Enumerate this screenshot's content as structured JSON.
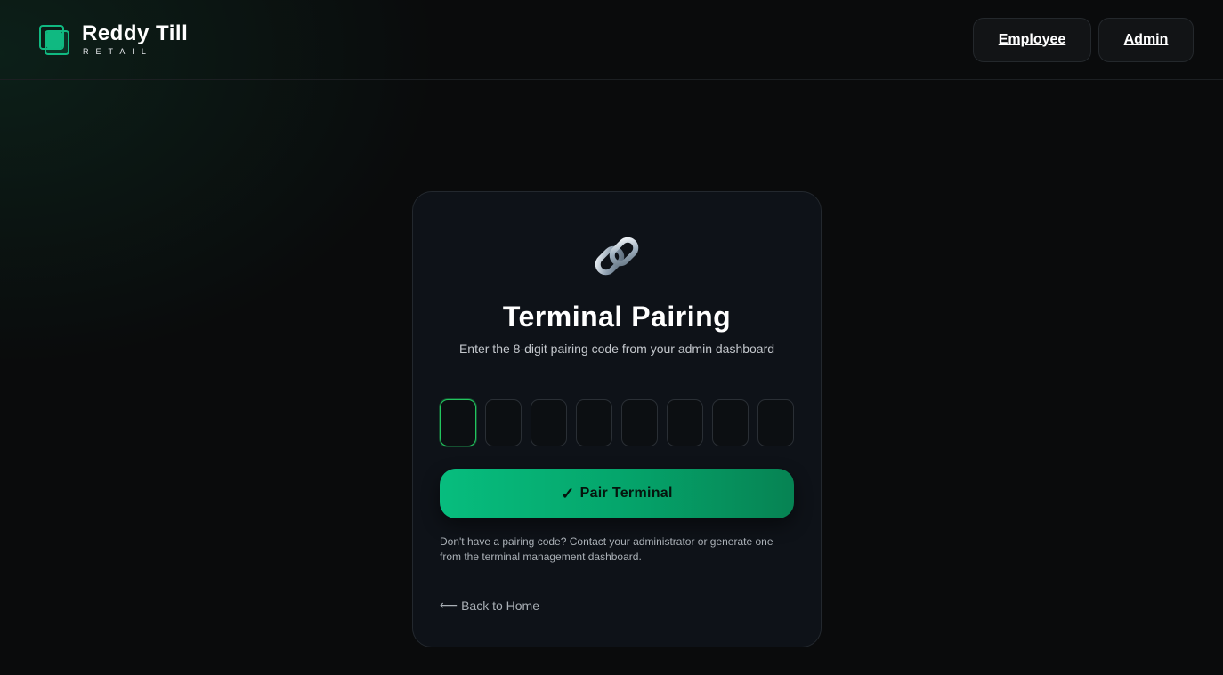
{
  "header": {
    "brand_name": "Reddy Till",
    "brand_sub": "RETAIL",
    "nav": {
      "employee_label": "Employee",
      "admin_label": "Admin"
    }
  },
  "card": {
    "icon": "link-icon",
    "title": "Terminal Pairing",
    "subtitle": "Enter the 8-digit pairing code from your admin dashboard",
    "code_digits": [
      "",
      "",
      "",
      "",
      "",
      "",
      "",
      ""
    ],
    "pair_check": "✓",
    "pair_label": "Pair Terminal",
    "help_text": "Don't have a pairing code? Contact your administrator or generate one from the terminal management dashboard.",
    "back_arrow": "⟵",
    "back_label": "Back to Home"
  },
  "colors": {
    "accent": "#10b981",
    "background": "#0a0b0c",
    "card": "#0e1218"
  }
}
